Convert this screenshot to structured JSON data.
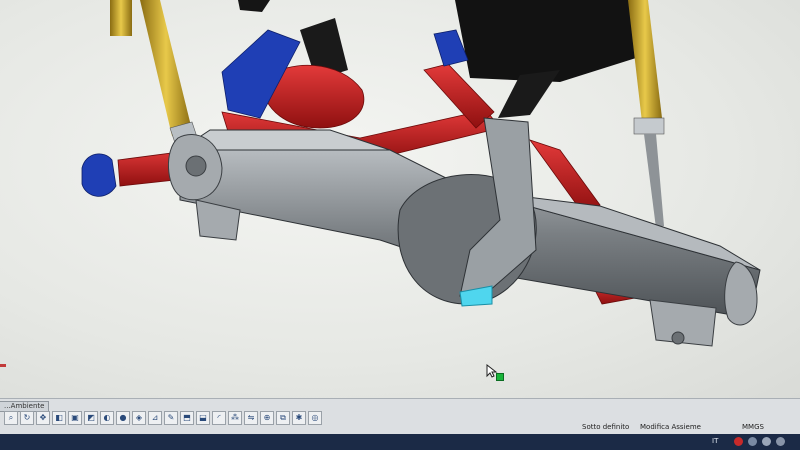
{
  "statusbar": {
    "command_tab": "...Ambiente",
    "status_1": "Sotto definito",
    "status_2": "Modifica Assieme",
    "units": "MMGS"
  },
  "taskbar": {
    "language": "IT"
  },
  "icons": {
    "toolbar": [
      "zoom-icon",
      "rotate-icon",
      "pan-icon",
      "section-icon",
      "view-icon",
      "display-icon",
      "hide-icon",
      "appearance-icon",
      "scene-icon",
      "measure-icon",
      "sketch-icon",
      "extrude-icon",
      "cut-icon",
      "fillet-icon",
      "pattern-icon",
      "mirror-icon",
      "mate-icon",
      "assembly-icon",
      "explode-icon",
      "render-icon"
    ]
  },
  "colors": {
    "axle_housing": "#7d8286",
    "control_arm": "#c11d1d",
    "bracket_blue": "#1f3fb5",
    "shock_gold": "#c9a52a",
    "selected_face": "#4fd6ee"
  }
}
